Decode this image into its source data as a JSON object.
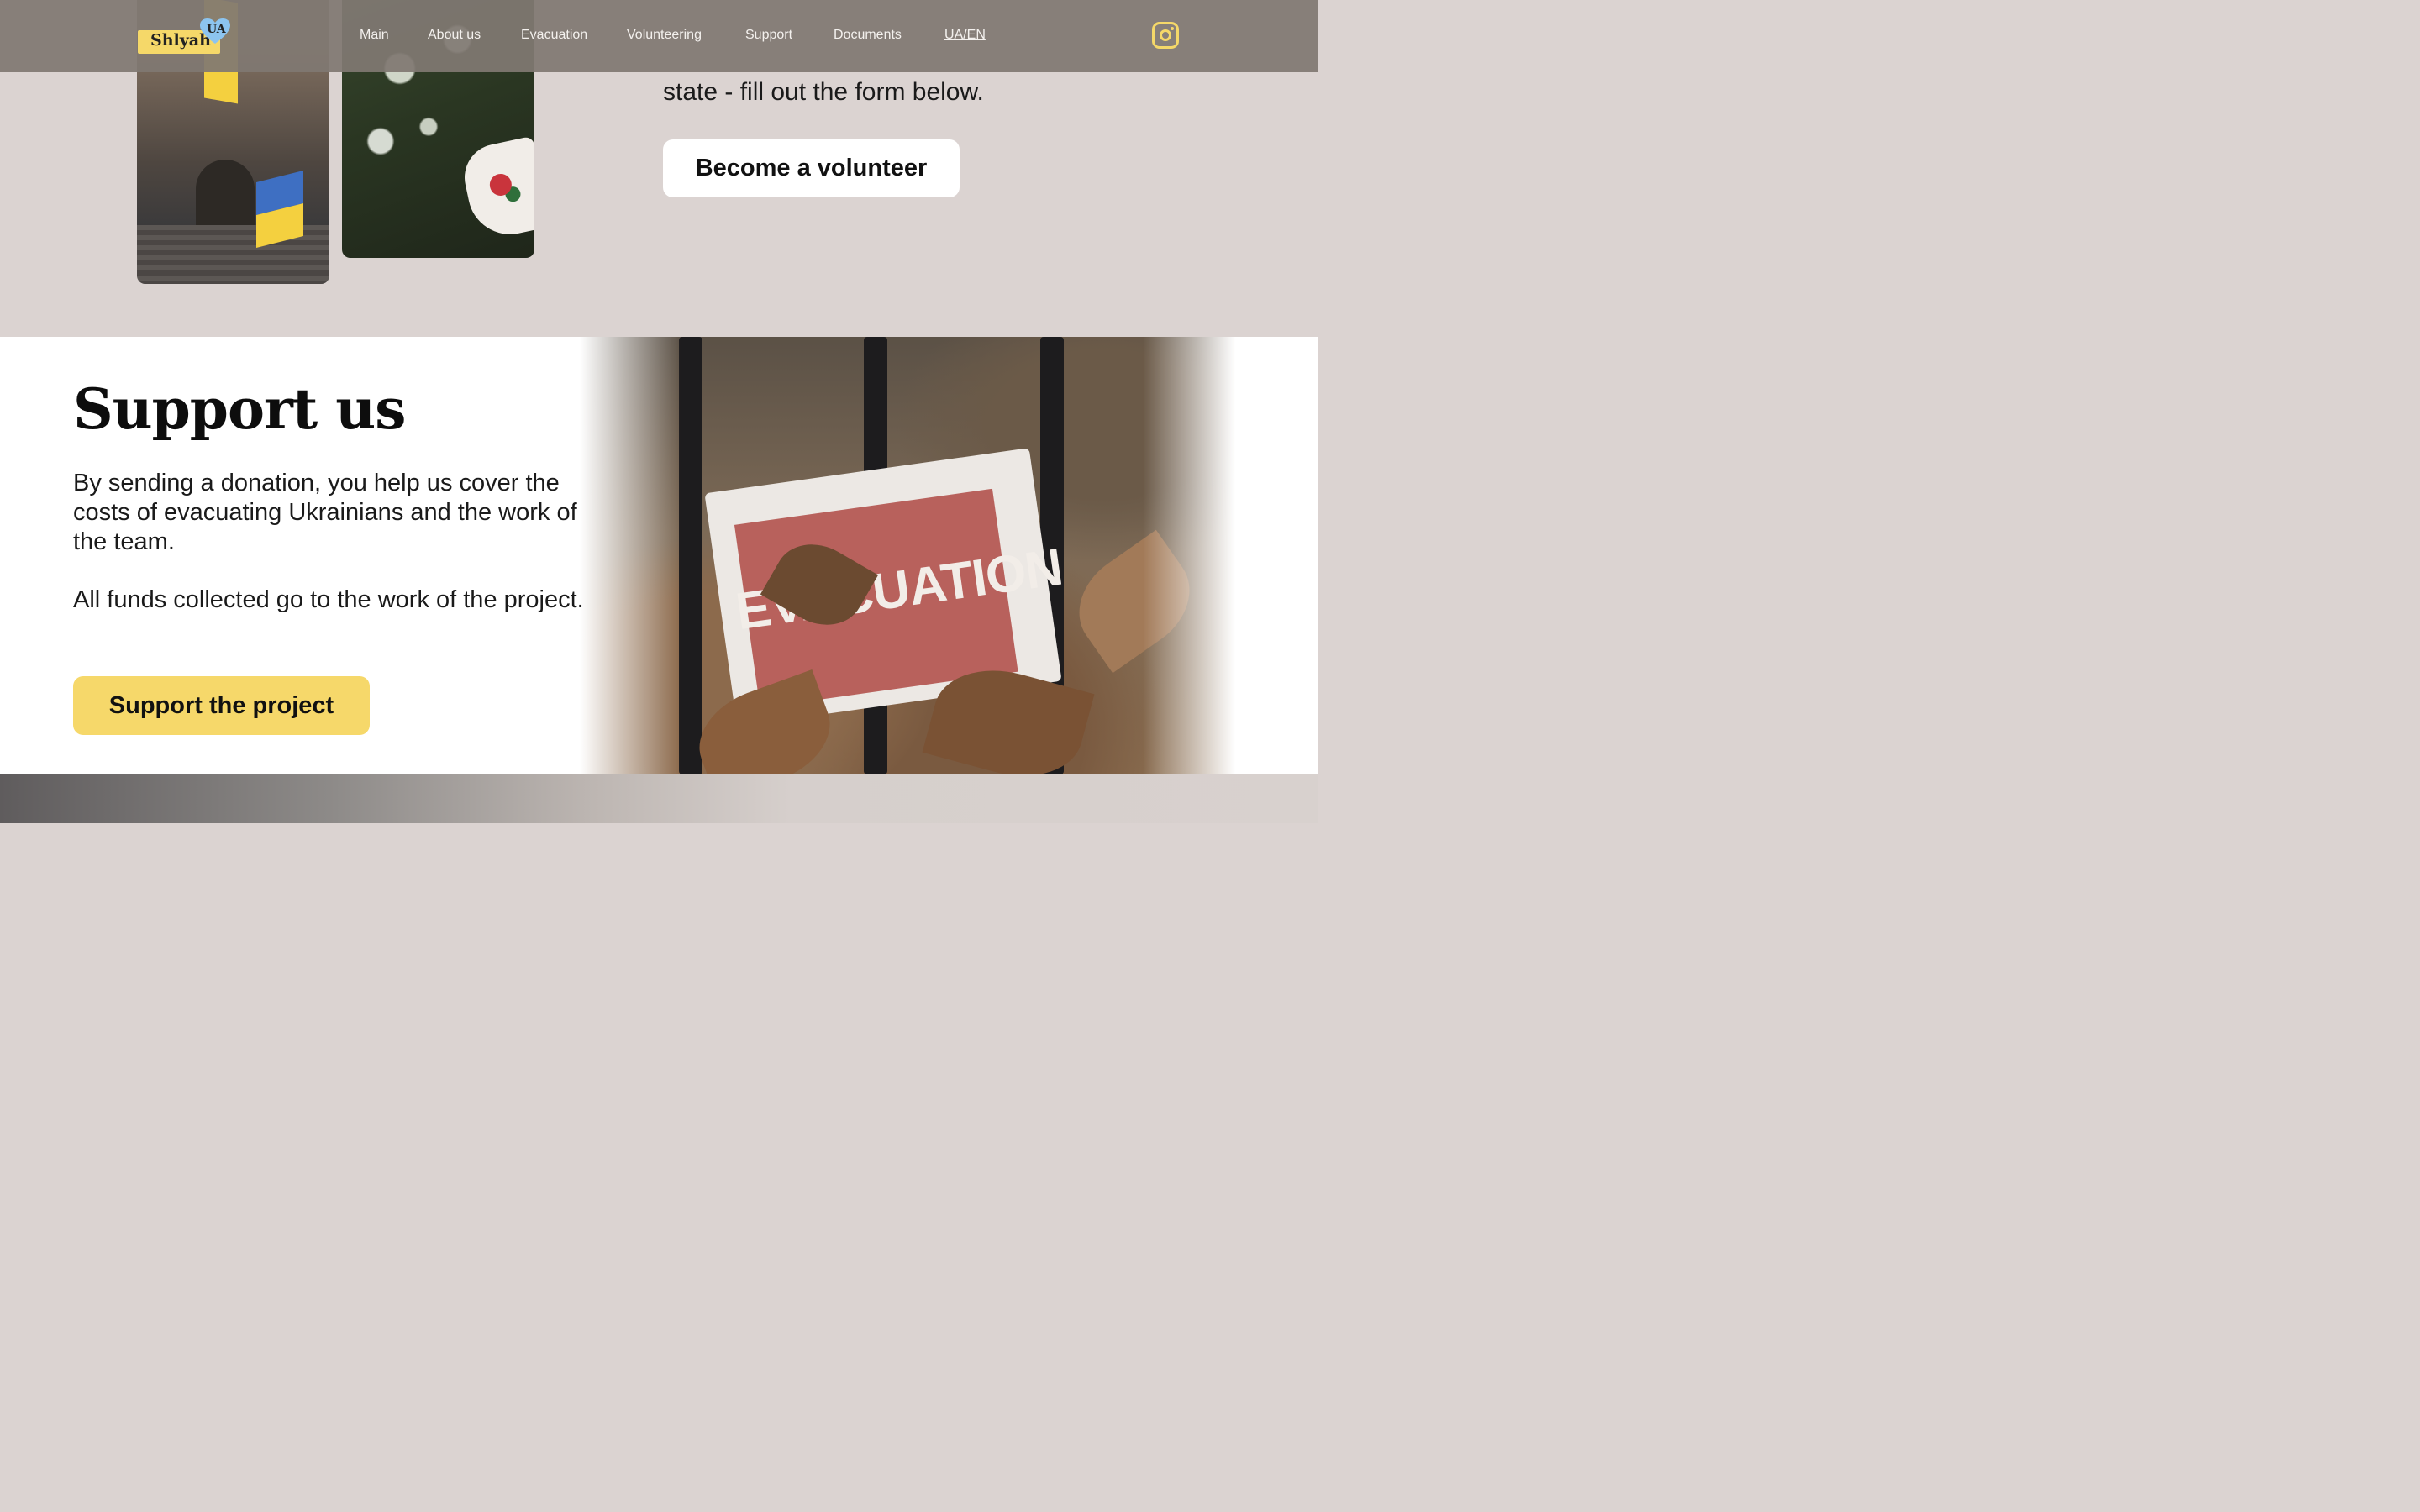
{
  "header": {
    "logo": {
      "name": "Shlyah",
      "badge": "UA"
    },
    "nav": [
      {
        "label": "Main"
      },
      {
        "label": "About us"
      },
      {
        "label": "Evacuation"
      },
      {
        "label": "Volunteering"
      },
      {
        "label": "Support"
      },
      {
        "label": "Documents"
      },
      {
        "label": "UA/EN"
      }
    ],
    "social_icon": "instagram-icon"
  },
  "volunteer": {
    "text_visible": "state - fill out the form below.",
    "button_label": "Become a volunteer"
  },
  "support": {
    "title": "Support us",
    "paragraph_1": "By sending a donation, you help us cover the costs of evacuating Ukrainians and the work of the team.",
    "paragraph_2": "All funds collected go to the work of the project.",
    "button_label": "Support the project",
    "photo_sign_text": "EVACUATION"
  },
  "colors": {
    "accent_yellow": "#f6d86a",
    "header_bg": "#807872",
    "section_bg": "#dbd3d1"
  }
}
